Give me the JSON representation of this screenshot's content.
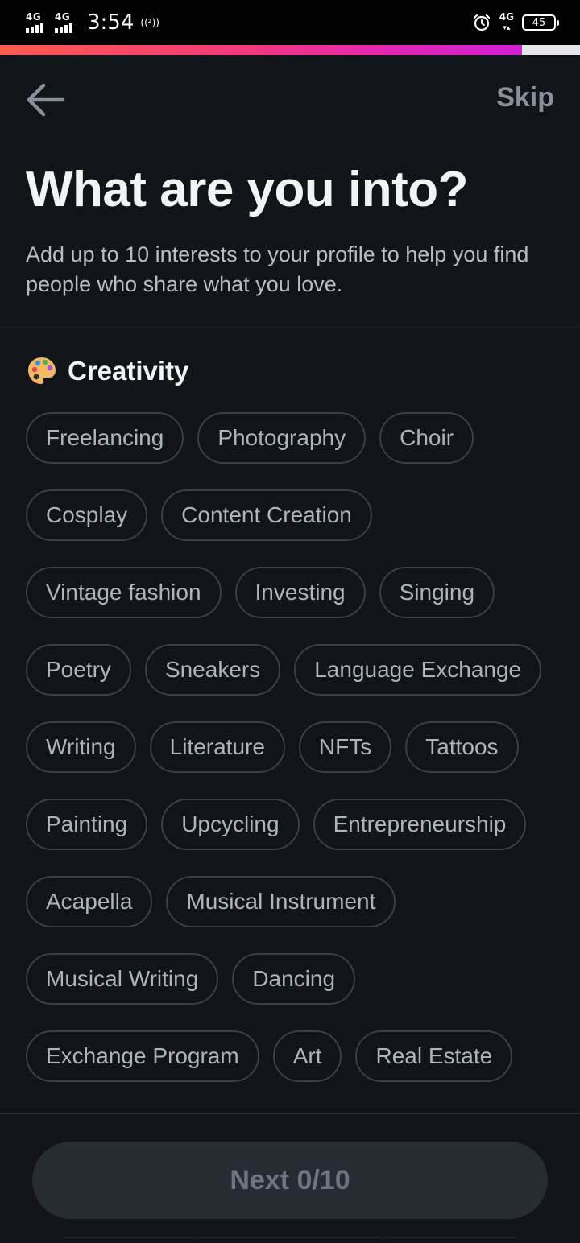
{
  "status_bar": {
    "network_1": "4G",
    "network_2": "4G",
    "time": "3:54",
    "hotspot": "((²))",
    "network_right": "4G",
    "battery": "45"
  },
  "progress": {
    "fraction": 0.9
  },
  "header": {
    "skip_label": "Skip",
    "title": "What are you into?",
    "subtitle": "Add up to 10 interests to your profile to help you find people who share what you love."
  },
  "section": {
    "emoji": "🎨",
    "title": "Creativity"
  },
  "interests": [
    [
      "Freelancing",
      "Photography",
      "Choir"
    ],
    [
      "Cosplay",
      "Content Creation"
    ],
    [
      "Vintage fashion",
      "Investing",
      "Singing"
    ],
    [
      "Poetry",
      "Sneakers",
      "Language Exchange"
    ],
    [
      "Writing",
      "Literature",
      "NFTs",
      "Tattoos"
    ],
    [
      "Painting",
      "Upcycling",
      "Entrepreneurship"
    ],
    [
      "Acapella",
      "Musical Instrument"
    ],
    [
      "Musical Writing",
      "Dancing"
    ],
    [
      "Exchange Program",
      "Art",
      "Real Estate"
    ]
  ],
  "footer": {
    "next_label": "Next 0/10"
  },
  "colors": {
    "background": "#111418",
    "accent_start": "#fd5b4e",
    "accent_end": "#d31fd6",
    "chip_border": "#3a3f48"
  }
}
